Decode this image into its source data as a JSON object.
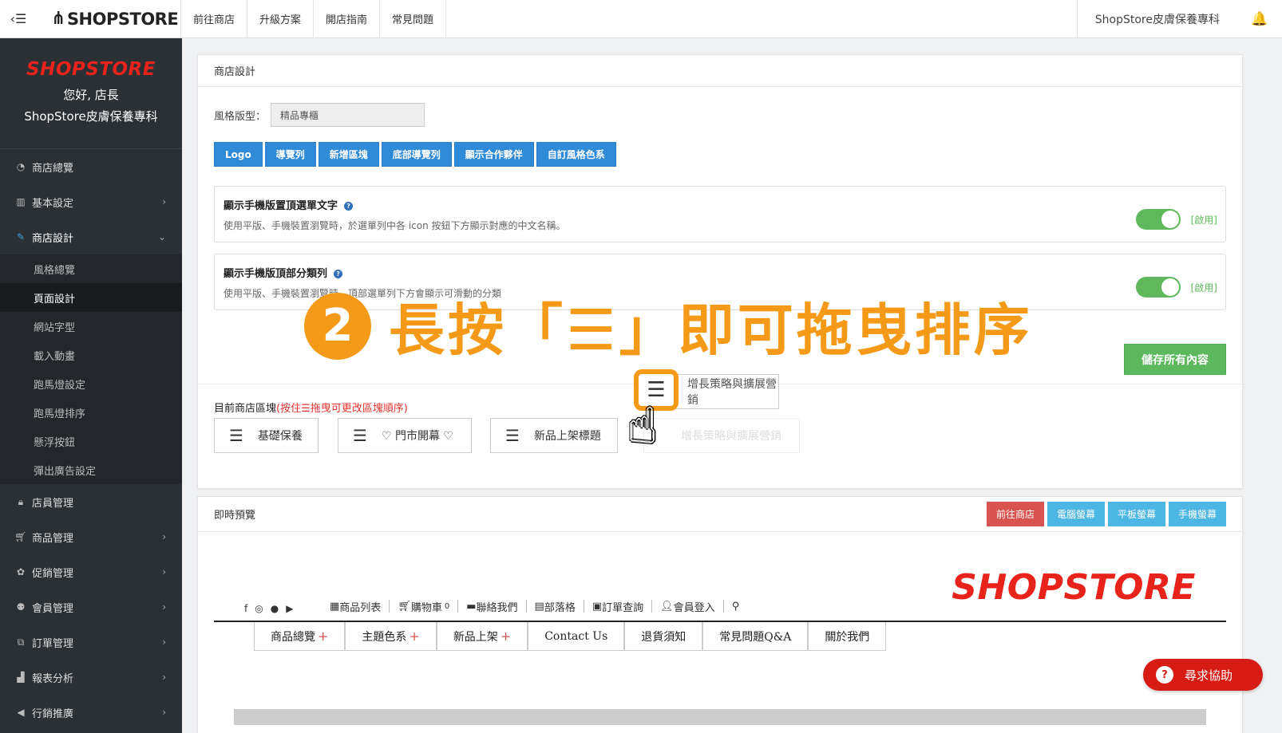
{
  "topbar": {
    "brand": "SHOPSTORE",
    "nav": [
      "前往商店",
      "升級方案",
      "開店指南",
      "常見問題"
    ],
    "store_name": "ShopStore皮膚保養專科"
  },
  "sidebar": {
    "logo": "SHOPSTORE",
    "greeting": "您好, 店長",
    "store_name": "ShopStore皮膚保養專科",
    "items": [
      {
        "label": "商店總覽",
        "icon": "dashboard-icon"
      },
      {
        "label": "基本設定",
        "icon": "bank-icon"
      },
      {
        "label": "商店設計",
        "icon": "wand-icon"
      },
      {
        "label": "店員管理",
        "icon": "lock-icon"
      },
      {
        "label": "商品管理",
        "icon": "cart-icon"
      },
      {
        "label": "促銷管理",
        "icon": "gift-icon"
      },
      {
        "label": "會員管理",
        "icon": "users-icon"
      },
      {
        "label": "訂單管理",
        "icon": "copy-icon"
      },
      {
        "label": "報表分析",
        "icon": "bar-chart-icon"
      },
      {
        "label": "行銷推廣",
        "icon": "bullhorn-icon"
      }
    ],
    "sub_items": [
      "風格總覽",
      "頁面設計",
      "網站字型",
      "載入動畫",
      "跑馬燈設定",
      "跑馬燈排序",
      "懸浮按鈕",
      "彈出廣告設定"
    ]
  },
  "design": {
    "title": "商店設計",
    "style_label": "風格版型：",
    "style_value": "精品專櫃",
    "buttons": [
      "Logo",
      "導覽列",
      "新增區塊",
      "底部導覽列",
      "顯示合作夥伴",
      "自訂風格色系"
    ],
    "option1": {
      "title": "顯示手機版置頂選單文字",
      "desc": "使用平版、手機裝置瀏覽時，於選單列中各 icon 按鈕下方顯示對應的中文名稱。",
      "state": "[啟用]"
    },
    "option2": {
      "title": "顯示手機版頂部分類列",
      "desc": "使用平版、手機裝置瀏覽時，頂部選單列下方會顯示可滑動的分類",
      "state": "[啟用]"
    },
    "save_label": "儲存所有內容",
    "blocks_label": "目前商店區塊",
    "blocks_hint": "(按住☰拖曳可更改區塊順序)",
    "blocks": [
      "基礎保養",
      "♡ 門市開幕 ♡",
      "新品上架標題",
      "增長策略與擴展營銷"
    ],
    "dragging_block": "增長策略與擴展營銷",
    "overlay_num": "2",
    "overlay_text": "長按「☰」即可拖曳排序"
  },
  "preview": {
    "title": "即時預覽",
    "tabs": [
      "前往商店",
      "電腦螢幕",
      "平板螢幕",
      "手機螢幕"
    ],
    "logo": "SHOPSTORE",
    "social_icons": [
      "facebook-icon",
      "instagram-icon",
      "line-icon",
      "youtube-icon"
    ],
    "links": [
      "商品列表",
      "購物車",
      "聯絡我們",
      "部落格",
      "訂單查詢",
      "會員登入"
    ],
    "cart_count": "0",
    "nav": [
      "商品總覽",
      "主題色系",
      "新品上架",
      "Contact Us",
      "退貨須知",
      "常見問題Q&A",
      "關於我們"
    ]
  },
  "help_chat": "尋求協助",
  "colors": {
    "accent_orange": "#f59a18",
    "brand_red": "#e8231c",
    "primary_blue": "#2f8ad8",
    "success_green": "#5cb85c"
  }
}
